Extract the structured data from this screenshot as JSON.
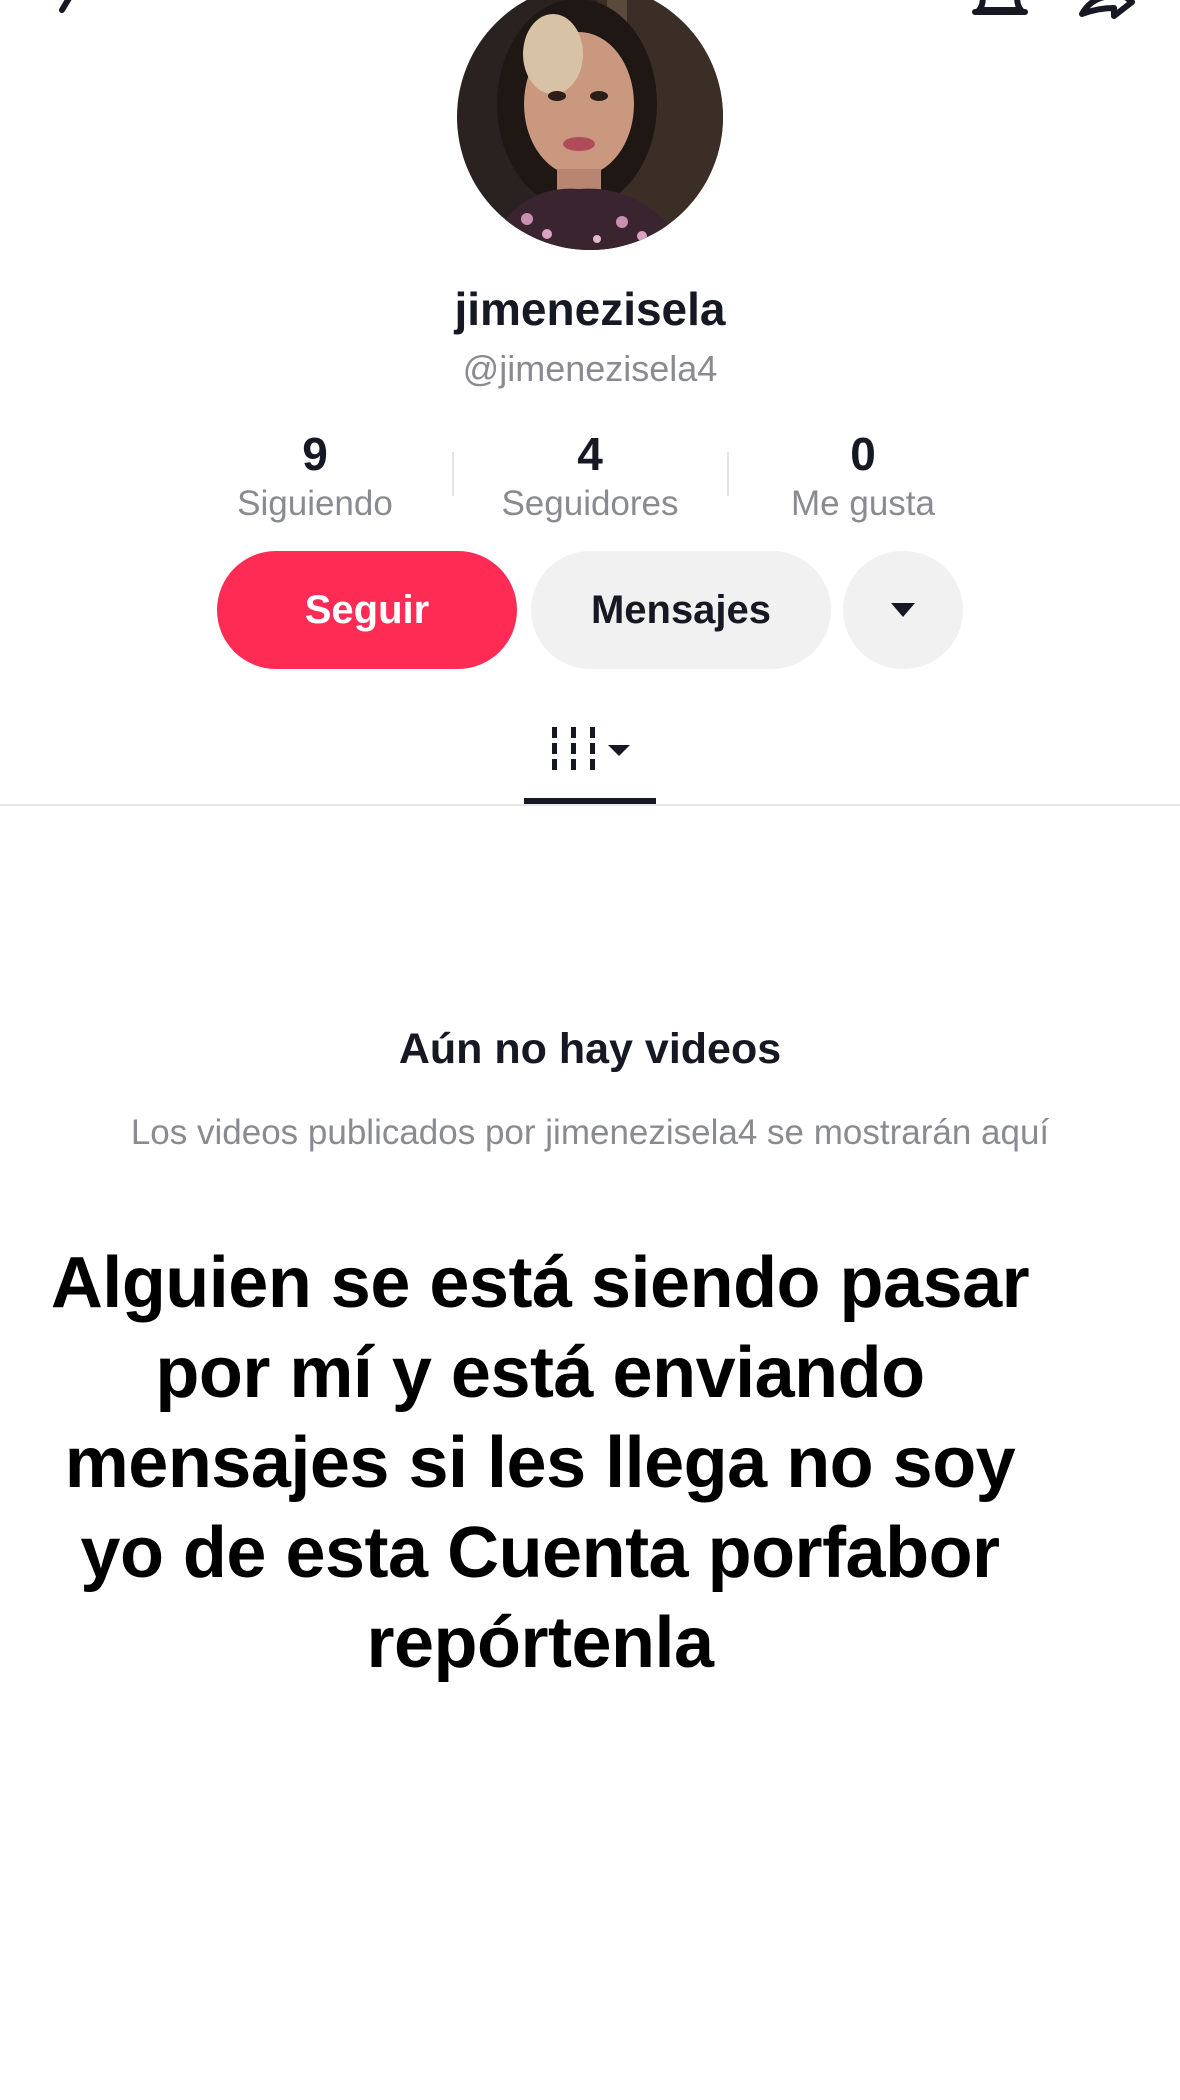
{
  "profile": {
    "display_name": "jimenezisela",
    "handle": "@jimenezisela4"
  },
  "stats": [
    {
      "value": "9",
      "label": "Siguiendo"
    },
    {
      "value": "4",
      "label": "Seguidores"
    },
    {
      "value": "0",
      "label": "Me gusta"
    }
  ],
  "actions": {
    "follow_label": "Seguir",
    "message_label": "Mensajes"
  },
  "empty_state": {
    "title": "Aún no hay videos",
    "subtitle": "Los videos publicados por jimenezisela4 se mostrarán aquí"
  },
  "overlay_caption": "Alguien se está siendo pasar por mí y está enviando mensajes si les llega no soy yo de esta Cuenta porfabor repórtenla",
  "icons": {
    "back": "back-arrow-icon",
    "notifications": "bell-icon",
    "share": "share-icon",
    "dropdown": "caret-down-icon",
    "videos_tab": "videos-grid-icon"
  },
  "colors": {
    "accent": "#fe2c55",
    "secondary_button": "#f1f1f2",
    "text_primary": "#161823",
    "text_secondary": "#8a8b91"
  }
}
